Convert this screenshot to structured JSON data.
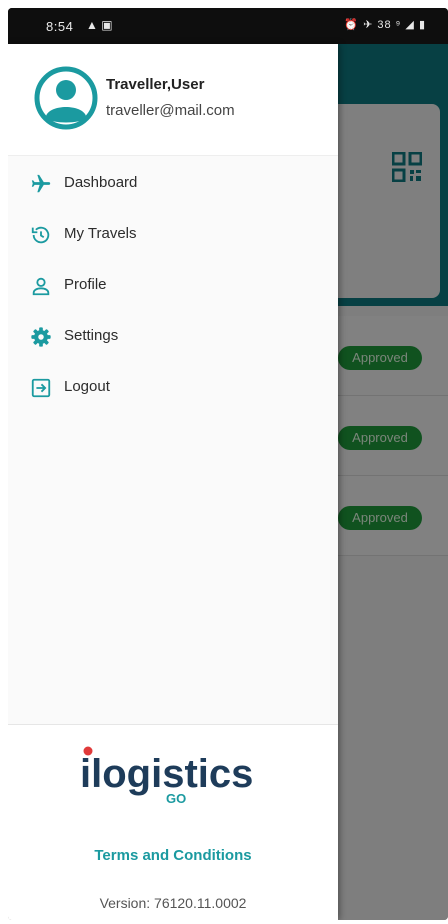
{
  "status_bar": {
    "time": "8:54",
    "left_icons": "▲ ▣",
    "right_icons": "⏰ ✈ 38 ⁹ ◢ ▮"
  },
  "user": {
    "name": "Traveller,User",
    "email": "traveller@mail.com"
  },
  "menu": [
    {
      "label": "Dashboard",
      "icon": "airplane-icon"
    },
    {
      "label": "My Travels",
      "icon": "history-icon"
    },
    {
      "label": "Profile",
      "icon": "person-icon"
    },
    {
      "label": "Settings",
      "icon": "gear-icon"
    },
    {
      "label": "Logout",
      "icon": "logout-icon"
    }
  ],
  "background": {
    "status_pills": [
      "Approved",
      "Approved",
      "Approved"
    ]
  },
  "footer": {
    "logo_text": "ilogistics",
    "logo_sub": "GO",
    "terms_label": "Terms and Conditions",
    "version": "Version: 76120.11.0002"
  },
  "colors": {
    "accent": "#1b9aa0",
    "header_teal": "#0e7c82",
    "logo_dark": "#1e3c5a",
    "approved_green": "#1f9d3c"
  }
}
